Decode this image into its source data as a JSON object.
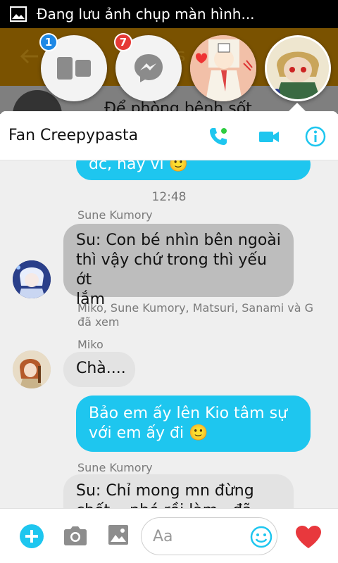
{
  "status_bar": {
    "text": "Đang lưu ảnh chụp màn hình...",
    "icon": "image-icon"
  },
  "background": {
    "header_text": "s   es",
    "message_text": "Để phòng bệnh sốt"
  },
  "chat_heads": [
    {
      "name": "chat-heads-manager",
      "badge": "1",
      "badge_color": "#1e88e5",
      "icon": "windows-icon"
    },
    {
      "name": "messenger",
      "badge": "7",
      "badge_color": "#e53935",
      "icon": "messenger-icon"
    },
    {
      "name": "contact-avatar-1"
    },
    {
      "name": "contact-avatar-2",
      "active": true
    }
  ],
  "conversation": {
    "title": "Fan Creepypasta",
    "actions": [
      "phone-icon",
      "video-camera-icon",
      "info-icon"
    ],
    "accent": "#1ec6ef"
  },
  "messages": [
    {
      "type": "mine",
      "text": "dc, hay vì 🙂"
    },
    {
      "type": "time",
      "text": "12:48"
    },
    {
      "type": "theirs",
      "sender": "Sune Kumory",
      "lines": [
        "Su: Con bé nhìn bên ngoài",
        "thì vậy chứ trong thì yếu ớt",
        "lắm"
      ]
    },
    {
      "type": "seen",
      "lines": [
        "Miko, Sune Kumory, Matsuri, Sanami và G",
        "đã xem"
      ]
    },
    {
      "type": "theirs",
      "sender": "Miko",
      "text": "Chà...."
    },
    {
      "type": "mine",
      "lines": [
        "Bảo em ấy lên Kio tâm sự",
        "với em ấy đi 🙂"
      ]
    },
    {
      "type": "theirs",
      "sender": "Sune Kumory",
      "lines": [
        "Su: Chỉ mong mn đừng",
        "chết... nhé rồi làm...đã"
      ]
    }
  ],
  "composer": {
    "placeholder": "Aa",
    "icons": [
      "plus-icon",
      "camera-icon",
      "gallery-icon",
      "emoji-icon",
      "heart-icon"
    ]
  }
}
